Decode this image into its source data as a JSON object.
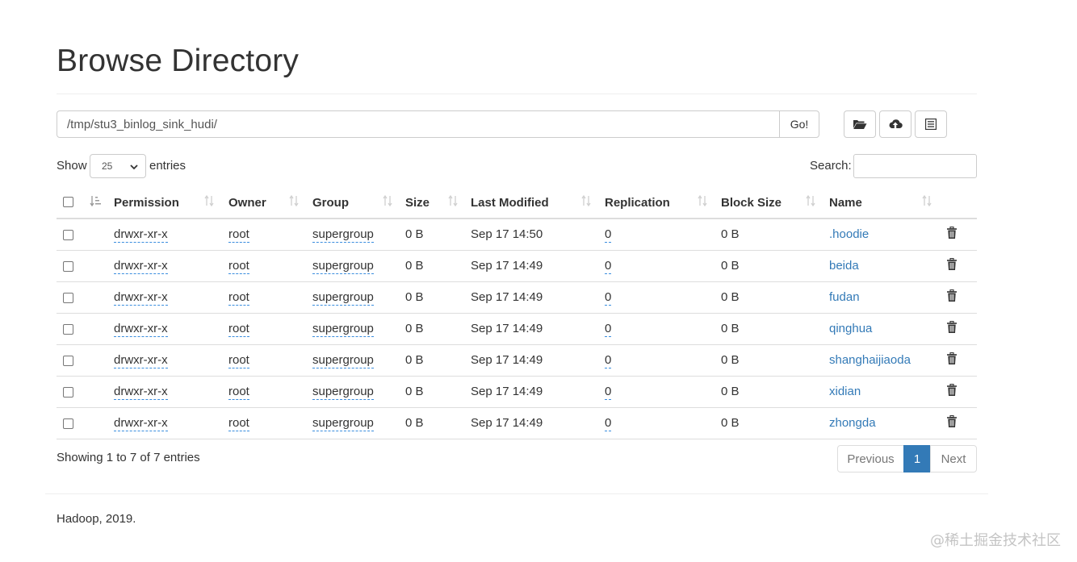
{
  "page": {
    "title": "Browse Directory"
  },
  "toolbar": {
    "path_value": "/tmp/stu3_binlog_sink_hudi/",
    "go_label": "Go!",
    "icons": [
      "folder-open-icon",
      "cloud-upload-icon",
      "list-icon"
    ]
  },
  "controls": {
    "show_label": "Show",
    "page_length": "25",
    "entries_label": "entries",
    "search_label": "Search:",
    "search_value": ""
  },
  "table": {
    "columns": [
      "Permission",
      "Owner",
      "Group",
      "Size",
      "Last Modified",
      "Replication",
      "Block Size",
      "Name"
    ],
    "rows": [
      {
        "permission": "drwxr-xr-x",
        "owner": "root",
        "group": "supergroup",
        "size": "0 B",
        "modified": "Sep 17 14:50",
        "replication": "0",
        "block_size": "0 B",
        "name": ".hoodie"
      },
      {
        "permission": "drwxr-xr-x",
        "owner": "root",
        "group": "supergroup",
        "size": "0 B",
        "modified": "Sep 17 14:49",
        "replication": "0",
        "block_size": "0 B",
        "name": "beida"
      },
      {
        "permission": "drwxr-xr-x",
        "owner": "root",
        "group": "supergroup",
        "size": "0 B",
        "modified": "Sep 17 14:49",
        "replication": "0",
        "block_size": "0 B",
        "name": "fudan"
      },
      {
        "permission": "drwxr-xr-x",
        "owner": "root",
        "group": "supergroup",
        "size": "0 B",
        "modified": "Sep 17 14:49",
        "replication": "0",
        "block_size": "0 B",
        "name": "qinghua"
      },
      {
        "permission": "drwxr-xr-x",
        "owner": "root",
        "group": "supergroup",
        "size": "0 B",
        "modified": "Sep 17 14:49",
        "replication": "0",
        "block_size": "0 B",
        "name": "shanghaijiaoda"
      },
      {
        "permission": "drwxr-xr-x",
        "owner": "root",
        "group": "supergroup",
        "size": "0 B",
        "modified": "Sep 17 14:49",
        "replication": "0",
        "block_size": "0 B",
        "name": "xidian"
      },
      {
        "permission": "drwxr-xr-x",
        "owner": "root",
        "group": "supergroup",
        "size": "0 B",
        "modified": "Sep 17 14:49",
        "replication": "0",
        "block_size": "0 B",
        "name": "zhongda"
      }
    ]
  },
  "table_footer": {
    "info": "Showing 1 to 7 of 7 entries",
    "previous_label": "Previous",
    "current_page": "1",
    "next_label": "Next"
  },
  "footer": {
    "text": "Hadoop, 2019."
  },
  "watermark": {
    "text": "@稀土掘金技术社区"
  },
  "colors": {
    "link": "#337ab7",
    "active_page": "#337ab7",
    "dotted_underline": "#3a8dde",
    "border": "#cccccc"
  }
}
